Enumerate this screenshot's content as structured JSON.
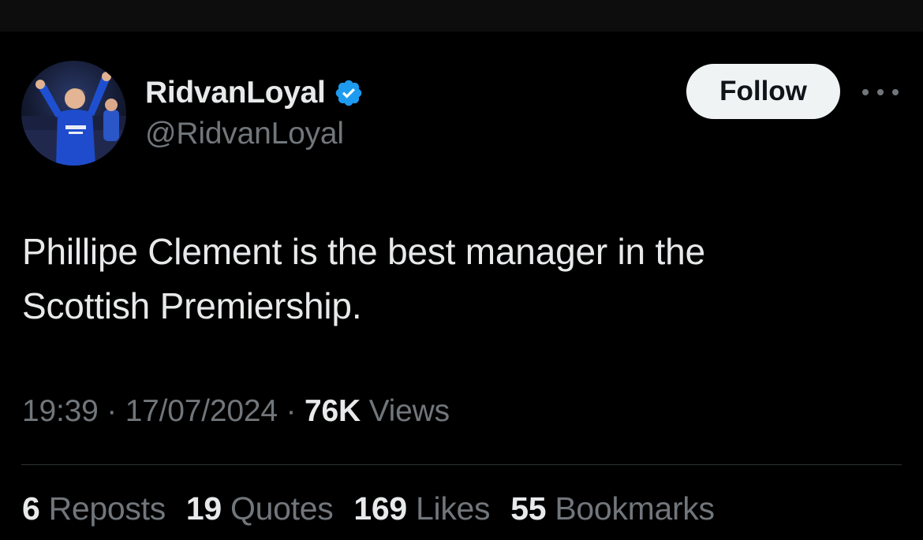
{
  "author": {
    "display_name": "RidvanLoyal",
    "handle": "@RidvanLoyal",
    "verified": true,
    "verified_color": "#1d9bf0"
  },
  "actions": {
    "follow_label": "Follow",
    "more_icon": "more-horizontal-icon"
  },
  "tweet": {
    "text_line1": "Phillipe Clement is the best manager in the",
    "text_line2": "Scottish Premiership.",
    "time": "19:39",
    "date": "17/07/2024",
    "views_count": "76K",
    "views_label": "Views",
    "separator": "·"
  },
  "stats": {
    "reposts_count": "6",
    "reposts_label": "Reposts",
    "quotes_count": "19",
    "quotes_label": "Quotes",
    "likes_count": "169",
    "likes_label": "Likes",
    "bookmarks_count": "55",
    "bookmarks_label": "Bookmarks"
  },
  "colors": {
    "background": "#000000",
    "primary_text": "#e7e9ea",
    "secondary_text": "#71767b",
    "divider": "#2f3336",
    "follow_bg": "#eff3f4"
  }
}
